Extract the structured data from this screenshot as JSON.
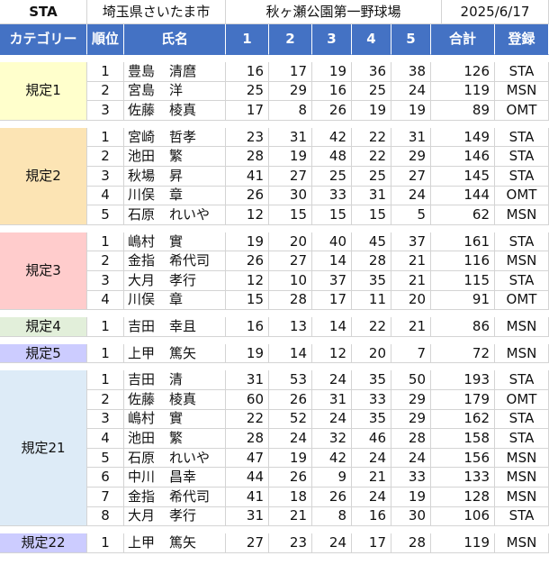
{
  "title_row": {
    "code": "STA",
    "location": "埼玉県さいたま市",
    "venue": "秋ヶ瀬公園第一野球場",
    "date": "2025/6/17"
  },
  "header": {
    "category": "カテゴリー",
    "rank": "順位",
    "name": "氏名",
    "r1": "1",
    "r2": "2",
    "r3": "3",
    "r4": "4",
    "r5": "5",
    "total": "合計",
    "reg": "登録"
  },
  "colors": {
    "header_bg": "#4472c4",
    "cat_1": "#ffffcc",
    "cat_2": "#fce4b4",
    "cat_3": "#ffcccc",
    "cat_4": "#e2efda",
    "cat_5": "#ccccff",
    "cat_21": "#ddebf7",
    "cat_22": "#ccccff"
  },
  "groups": [
    {
      "category": "規定1",
      "color_key": "cat_1",
      "rows": [
        {
          "rank": "1",
          "last": "豊島",
          "first": "清麿",
          "s": [
            "16",
            "17",
            "19",
            "36",
            "38"
          ],
          "total": "126",
          "reg": "STA"
        },
        {
          "rank": "2",
          "last": "宮島",
          "first": "洋",
          "s": [
            "25",
            "29",
            "16",
            "25",
            "24"
          ],
          "total": "119",
          "reg": "MSN"
        },
        {
          "rank": "3",
          "last": "佐藤",
          "first": "棱真",
          "s": [
            "17",
            "8",
            "26",
            "19",
            "19"
          ],
          "total": "89",
          "reg": "OMT"
        }
      ]
    },
    {
      "category": "規定2",
      "color_key": "cat_2",
      "rows": [
        {
          "rank": "1",
          "last": "宮崎",
          "first": "哲孝",
          "s": [
            "23",
            "31",
            "42",
            "22",
            "31"
          ],
          "total": "149",
          "reg": "STA"
        },
        {
          "rank": "2",
          "last": "池田",
          "first": "繁",
          "s": [
            "28",
            "19",
            "48",
            "22",
            "29"
          ],
          "total": "146",
          "reg": "STA"
        },
        {
          "rank": "3",
          "last": "秋場",
          "first": "昇",
          "s": [
            "41",
            "27",
            "25",
            "25",
            "27"
          ],
          "total": "145",
          "reg": "STA"
        },
        {
          "rank": "4",
          "last": "川俣",
          "first": "章",
          "s": [
            "26",
            "30",
            "33",
            "31",
            "24"
          ],
          "total": "144",
          "reg": "OMT"
        },
        {
          "rank": "5",
          "last": "石原",
          "first": "れいや",
          "s": [
            "12",
            "15",
            "15",
            "15",
            "5"
          ],
          "total": "62",
          "reg": "MSN"
        }
      ]
    },
    {
      "category": "規定3",
      "color_key": "cat_3",
      "rows": [
        {
          "rank": "1",
          "last": "嶋村",
          "first": "實",
          "s": [
            "19",
            "20",
            "40",
            "45",
            "37"
          ],
          "total": "161",
          "reg": "STA"
        },
        {
          "rank": "2",
          "last": "金指",
          "first": "希代司",
          "s": [
            "26",
            "27",
            "14",
            "28",
            "21"
          ],
          "total": "116",
          "reg": "MSN"
        },
        {
          "rank": "3",
          "last": "大月",
          "first": "孝行",
          "s": [
            "12",
            "10",
            "37",
            "35",
            "21"
          ],
          "total": "115",
          "reg": "STA"
        },
        {
          "rank": "4",
          "last": "川俣",
          "first": "章",
          "s": [
            "15",
            "28",
            "17",
            "11",
            "20"
          ],
          "total": "91",
          "reg": "OMT"
        }
      ]
    },
    {
      "category": "規定4",
      "color_key": "cat_4",
      "rows": [
        {
          "rank": "1",
          "last": "吉田",
          "first": "幸且",
          "s": [
            "16",
            "13",
            "14",
            "22",
            "21"
          ],
          "total": "86",
          "reg": "MSN"
        }
      ]
    },
    {
      "category": "規定5",
      "color_key": "cat_5",
      "rows": [
        {
          "rank": "1",
          "last": "上甲",
          "first": "篤矢",
          "s": [
            "19",
            "14",
            "12",
            "20",
            "7"
          ],
          "total": "72",
          "reg": "MSN"
        }
      ]
    },
    {
      "category": "規定21",
      "color_key": "cat_21",
      "rows": [
        {
          "rank": "1",
          "last": "吉田",
          "first": "清",
          "s": [
            "31",
            "53",
            "24",
            "35",
            "50"
          ],
          "total": "193",
          "reg": "STA"
        },
        {
          "rank": "2",
          "last": "佐藤",
          "first": "棱真",
          "s": [
            "60",
            "26",
            "31",
            "33",
            "29"
          ],
          "total": "179",
          "reg": "OMT"
        },
        {
          "rank": "3",
          "last": "嶋村",
          "first": "實",
          "s": [
            "22",
            "52",
            "24",
            "35",
            "29"
          ],
          "total": "162",
          "reg": "STA"
        },
        {
          "rank": "4",
          "last": "池田",
          "first": "繁",
          "s": [
            "28",
            "24",
            "32",
            "46",
            "28"
          ],
          "total": "158",
          "reg": "STA"
        },
        {
          "rank": "5",
          "last": "石原",
          "first": "れいや",
          "s": [
            "47",
            "19",
            "42",
            "24",
            "24"
          ],
          "total": "156",
          "reg": "MSN"
        },
        {
          "rank": "6",
          "last": "中川",
          "first": "昌幸",
          "s": [
            "44",
            "26",
            "9",
            "21",
            "33"
          ],
          "total": "133",
          "reg": "MSN"
        },
        {
          "rank": "7",
          "last": "金指",
          "first": "希代司",
          "s": [
            "41",
            "18",
            "26",
            "24",
            "19"
          ],
          "total": "128",
          "reg": "MSN"
        },
        {
          "rank": "8",
          "last": "大月",
          "first": "孝行",
          "s": [
            "31",
            "21",
            "8",
            "16",
            "30"
          ],
          "total": "106",
          "reg": "STA"
        }
      ]
    },
    {
      "category": "規定22",
      "color_key": "cat_22",
      "rows": [
        {
          "rank": "1",
          "last": "上甲",
          "first": "篤矢",
          "s": [
            "27",
            "23",
            "24",
            "17",
            "28"
          ],
          "total": "119",
          "reg": "MSN"
        }
      ]
    }
  ]
}
